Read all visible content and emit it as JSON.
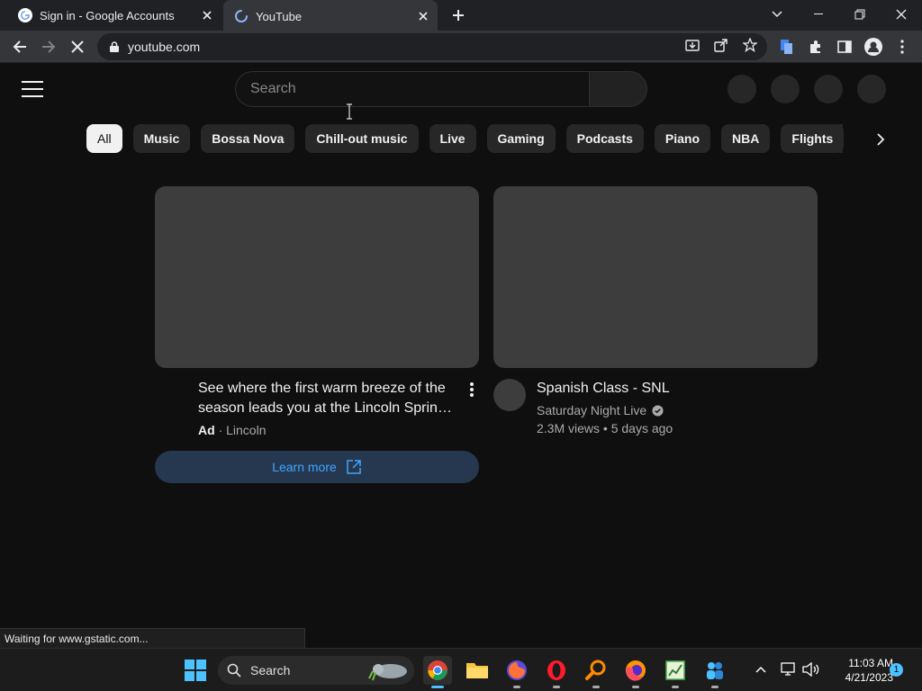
{
  "browser": {
    "tabs": [
      {
        "title": "Sign in - Google Accounts",
        "favicon": "google-g-icon",
        "active": false
      },
      {
        "title": "YouTube",
        "favicon": "loading-spinner-icon",
        "active": true
      }
    ],
    "url": "youtube.com",
    "status_text": "Waiting for www.gstatic.com..."
  },
  "youtube": {
    "search_placeholder": "Search",
    "chips": [
      "All",
      "Music",
      "Bossa Nova",
      "Chill-out music",
      "Live",
      "Gaming",
      "Podcasts",
      "Piano",
      "NBA",
      "Flights"
    ],
    "selected_chip": "All",
    "ad_video": {
      "title_line1": "See where the first warm breeze of the",
      "title_line2": "season leads you at the Lincoln Sprin…",
      "ad_label": "Ad",
      "separator": "·",
      "advertiser": "Lincoln",
      "cta": "Learn more"
    },
    "video": {
      "title": "Spanish Class - SNL",
      "channel": "Saturday Night Live",
      "views": "2.3M views",
      "separator": "•",
      "age": "5 days ago"
    }
  },
  "taskbar": {
    "search_label": "Search",
    "time": "11:03 AM",
    "date": "4/21/2023",
    "notification_count": "1"
  },
  "colors": {
    "accent_blue": "#3ea6ff",
    "ad_button_bg": "#263850",
    "youtube_bg": "#0f0f0f"
  }
}
